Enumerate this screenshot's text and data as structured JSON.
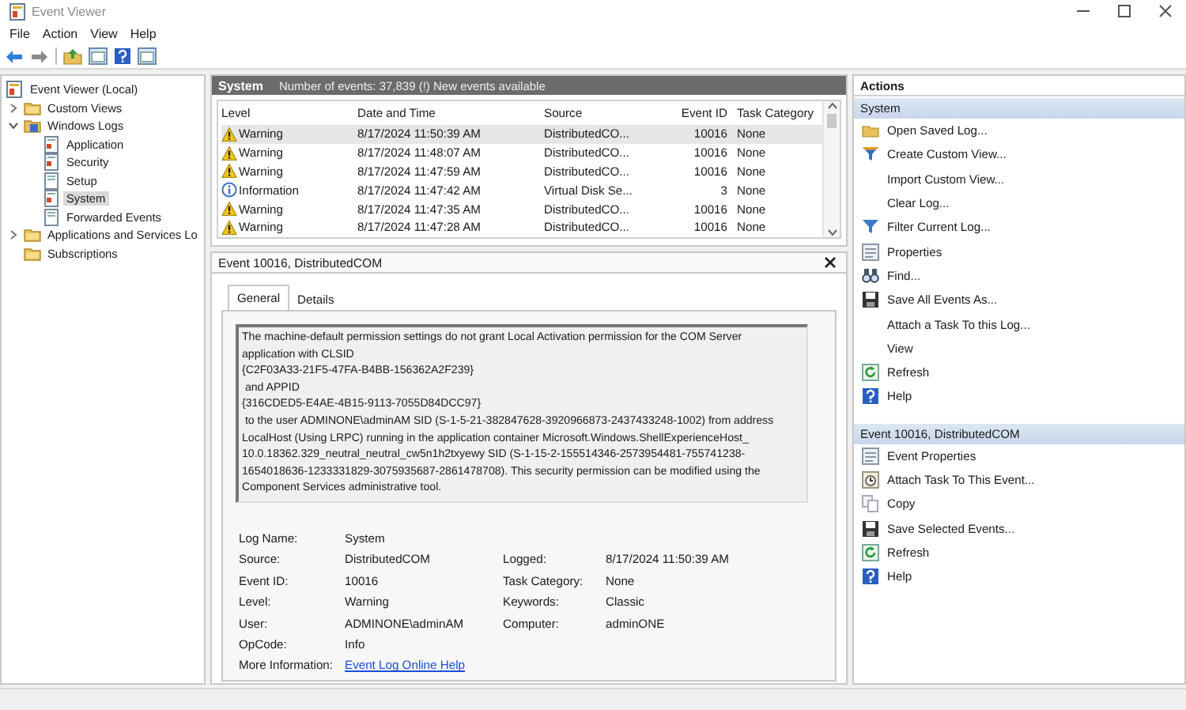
{
  "window": {
    "title": "Event Viewer"
  },
  "menu": [
    "File",
    "Action",
    "View",
    "Help"
  ],
  "tree": [
    {
      "label": "Event Viewer (Local)",
      "kind": "root",
      "selected": false,
      "children": [
        {
          "label": "Custom Views",
          "kind": "folder",
          "selected": false,
          "expanded": false
        },
        {
          "label": "Windows Logs",
          "kind": "logs",
          "selected": false,
          "expanded": true,
          "children": [
            {
              "label": "Application",
              "kind": "log",
              "selected": false
            },
            {
              "label": "Security",
              "kind": "log",
              "selected": false
            },
            {
              "label": "Setup",
              "kind": "plain",
              "selected": false
            },
            {
              "label": "System",
              "kind": "log",
              "selected": true
            },
            {
              "label": "Forwarded Events",
              "kind": "plain",
              "selected": false
            }
          ]
        },
        {
          "label": "Applications and Services Lo",
          "kind": "folder",
          "selected": false,
          "expanded": false
        },
        {
          "label": "Subscriptions",
          "kind": "folder",
          "selected": false
        }
      ]
    }
  ],
  "events": {
    "title": "System",
    "summary": "Number of events: 37,839 (!) New events available",
    "columns": [
      "Level",
      "Date and Time",
      "Source",
      "Event ID",
      "Task Category"
    ],
    "rows": [
      {
        "kind": "warning",
        "level": "Warning",
        "date": "8/17/2024 11:50:39 AM",
        "source": "DistributedCO...",
        "event_id": "10016",
        "task_category": "None",
        "selected": true
      },
      {
        "kind": "warning",
        "level": "Warning",
        "date": "8/17/2024 11:48:07 AM",
        "source": "DistributedCO...",
        "event_id": "10016",
        "task_category": "None",
        "selected": false
      },
      {
        "kind": "warning",
        "level": "Warning",
        "date": "8/17/2024 11:47:59 AM",
        "source": "DistributedCO...",
        "event_id": "10016",
        "task_category": "None",
        "selected": false
      },
      {
        "kind": "information",
        "level": "Information",
        "date": "8/17/2024 11:47:42 AM",
        "source": "Virtual Disk Se...",
        "event_id": "3",
        "task_category": "None",
        "selected": false
      },
      {
        "kind": "warning",
        "level": "Warning",
        "date": "8/17/2024 11:47:35 AM",
        "source": "DistributedCO...",
        "event_id": "10016",
        "task_category": "None",
        "selected": false
      },
      {
        "kind": "warning",
        "level": "Warning",
        "date": "8/17/2024 11:47:28 AM",
        "source": "DistributedCO...",
        "event_id": "10016",
        "task_category": "None",
        "selected": false
      }
    ]
  },
  "detail": {
    "title": "Event 10016, DistributedCOM",
    "tabs": [
      {
        "label": "General",
        "selected": true
      },
      {
        "label": "Details",
        "selected": false
      }
    ],
    "description": "The machine-default permission settings do not grant Local Activation permission for the COM Server\napplication with CLSID\n{C2F03A33-21F5-47FA-B4BB-156362A2F239}\n and APPID\n{316CDED5-E4AE-4B15-9113-7055D84DCC97}\n to the user ADMINONE\\adminAM SID (S-1-5-21-382847628-3920966873-2437433248-1002) from address\nLocalHost (Using LRPC) running in the application container Microsoft.Windows.ShellExperienceHost_\n10.0.18362.329_neutral_neutral_cw5n1h2txyewy SID (S-1-15-2-155514346-2573954481-755741238-\n1654018636-1233331829-3075935687-2861478708). This security permission can be modified using the\nComponent Services administrative tool.",
    "properties": [
      [
        {
          "label": "Log Name:",
          "value": "System",
          "kind": "text"
        }
      ],
      [
        {
          "label": "Source:",
          "value": "DistributedCOM",
          "kind": "text"
        },
        {
          "label": "Logged:",
          "value": "8/17/2024 11:50:39 AM",
          "kind": "text"
        }
      ],
      [
        {
          "label": "Event ID:",
          "value": "10016",
          "kind": "text"
        },
        {
          "label": "Task Category:",
          "value": "None",
          "kind": "text"
        }
      ],
      [
        {
          "label": "Level:",
          "value": "Warning",
          "kind": "text"
        },
        {
          "label": "Keywords:",
          "value": "Classic",
          "kind": "text"
        }
      ],
      [
        {
          "label": "User:",
          "value": "ADMINONE\\adminAM",
          "kind": "text"
        },
        {
          "label": "Computer:",
          "value": "adminONE",
          "kind": "text"
        }
      ],
      [
        {
          "label": "OpCode:",
          "value": "Info",
          "kind": "text"
        }
      ],
      [
        {
          "label": "More Information:",
          "value": "Event Log Online Help",
          "kind": "link"
        }
      ]
    ]
  },
  "actions": {
    "title": "Actions",
    "sections": [
      {
        "title": "System",
        "items": [
          "Open Saved Log...",
          "Create Custom View...",
          "Import Custom View...",
          "Clear Log...",
          "Filter Current Log...",
          "Properties",
          "Find...",
          "Save All Events As...",
          "Attach a Task To this Log...",
          "View",
          "Refresh",
          "Help"
        ]
      },
      {
        "title": "Event 10016, DistributedCOM",
        "items": [
          "Event Properties",
          "Attach Task To This Event...",
          "Copy",
          "Save Selected Events...",
          "Refresh",
          "Help"
        ]
      }
    ]
  }
}
